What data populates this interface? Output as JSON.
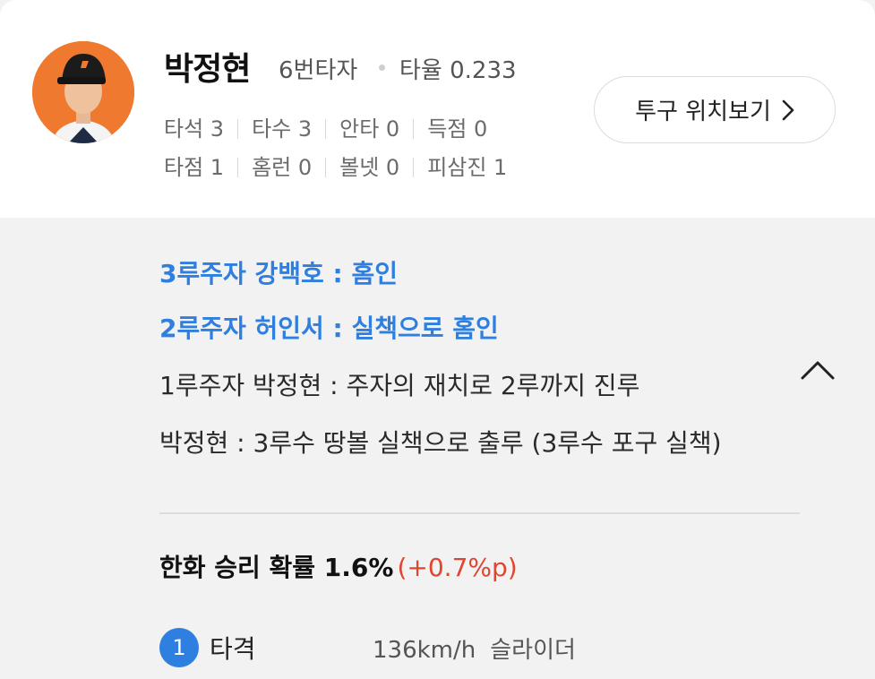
{
  "player": {
    "name": "박정현",
    "batting_order": "6번타자",
    "avg_label": "타율 0.233",
    "stats_row1": [
      "타석 3",
      "타수 3",
      "안타 0",
      "득점 0"
    ],
    "stats_row2": [
      "타점 1",
      "홈런 0",
      "볼넷 0",
      "피삼진 1"
    ]
  },
  "pitch_location_button": {
    "label": "투구 위치보기",
    "icon": "chevron-right-icon"
  },
  "plays": [
    {
      "text": "3루주자 강백호 : 홈인",
      "highlight": true
    },
    {
      "text": "2루주자 허인서 : 실책으로 홈인",
      "highlight": true
    },
    {
      "text": "1루주자 박정현 : 주자의 재치로 2루까지 진루",
      "highlight": false
    },
    {
      "text": "박정현 : 3루수 땅볼 실책으로 출루 (3루수 포구 실책)",
      "highlight": false
    }
  ],
  "collapse_icon": "chevron-up-icon",
  "win_probability": {
    "label": "한화 승리 확률 1.6%",
    "delta": "(+0.7%p)"
  },
  "pitch": {
    "number": "1",
    "result": "타격",
    "speed": "136km/h",
    "type": "슬라이더"
  },
  "colors": {
    "accent_blue": "#2f7fe0",
    "delta_red": "#e0452f",
    "avatar_orange": "#ef7a2f",
    "panel_gray": "#f2f2f2"
  }
}
